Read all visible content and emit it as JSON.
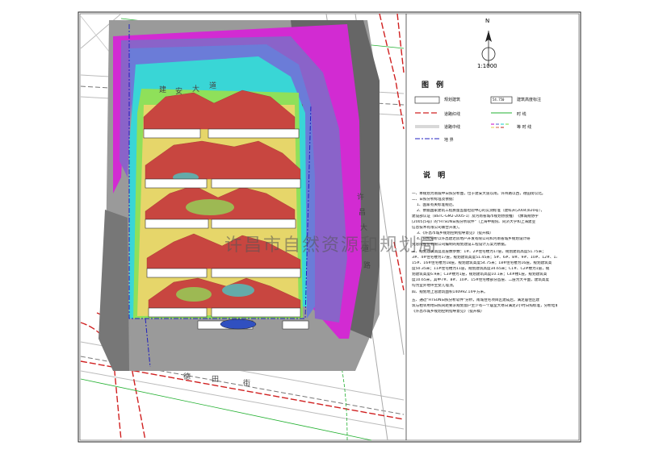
{
  "map": {
    "road_north": [
      "建",
      "安",
      "大",
      "道"
    ],
    "road_east": [
      "许",
      "昌",
      "大",
      "道",
      "路"
    ],
    "road_south": [
      "德",
      "田",
      "街"
    ],
    "watermark": "许昌市自然资源和规划局"
  },
  "north_arrow": {
    "letter": "N",
    "scale": "1:1000"
  },
  "legend": {
    "title": "图 例",
    "items": {
      "building": "规划建筑",
      "road_red_line": "道路红线",
      "road_center_line": "道路中线",
      "land_line": "地 界",
      "height_mark": "建筑高度标注",
      "height_mark_sample": "54.750",
      "hour_line": "时 线",
      "contour": "等 时 线"
    }
  },
  "notes": {
    "title": "说 明",
    "lines": [
      "一、本规划为南城中日照分析图，位于建安大道以南，许州路以西，德田街以北。",
      "二、日照分析标准及依据：",
      "1、国家有关标准规范。",
      "2、依据国家建筑工程质量监督检验中心的实测标准（建科开[2004]020号），",
      "建设部认证（BSTC-GM2-2005-1）及河南省城市规划协会推广《豫城规协字",
      "[2005]5号》的\"HTSUN日照分析软件\"（上海中规院、同济大学和上海建业",
      "信息技术有限公司联合开发）。",
      "3、《许昌市城乡规划控制指导意见》（提升稿）",
      "4、日照分析以许昌建达房地产开发有限公司和河南省城乡规划设计研",
      "究总院股份有限公司编制的规划建设工程设计方案为依据。",
      "三、规划建筑高度及层数参数：1#、2#住宅楼为17层，规划建筑高度51.75米；",
      "3#、4#住宅楼为17层，规划建筑高度51.45米；5#、6#、8#、9#、10#、12#、13#、",
      "15#、16#住宅楼为18层，规划建筑高度54.75米；18#住宅楼为16层，规划建筑高",
      "度50.35米；11#住宅楼为11层，规划建筑高度34.65米；C1#、C2#楼为1层，规",
      "划建筑高度6.9米；C3#楼为1层，规划建筑高度10.1米；C4#楼1层，规划建筑高",
      "度10.65米，其中7#、8#、10#、15#住宅楼部分首层、二层为大平面，建筑高度",
      "均为室外地坪至女儿墙顶。",
      "四、规划地上总建筑面积140992.14平方米。",
      "五、通过\"HTSUN日照分析软件\"分析，南城住宅项目区建成后，满足居住区建",
      "筑与相邻用地日照间距要求规划窗户至少有一个居室大寒日满足2小时日照标准，分析结果满足",
      "《许昌市城乡规划控制指导意见》（提升稿）"
    ]
  },
  "colors": {
    "gray": "#888888",
    "magenta": "#d22bd2",
    "violet": "#8a63c9",
    "blue": "#6b7cd8",
    "cyan": "#39d6d6",
    "lime": "#8fe05a",
    "yellow": "#e6d66a",
    "salmon": "#e07a60",
    "red": "#c84640",
    "road_red": "#d02020",
    "road_green": "#22b030",
    "land_blue": "#2020c0"
  }
}
